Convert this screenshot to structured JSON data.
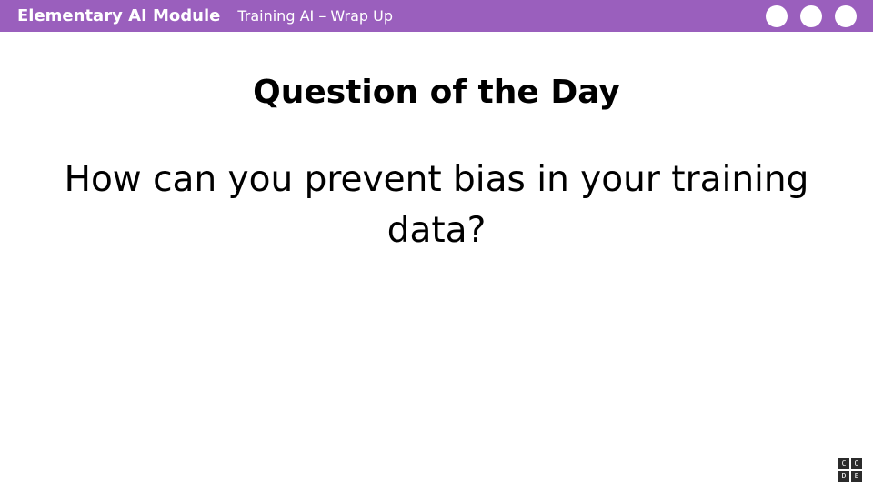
{
  "colors": {
    "header_bg": "#9a5fbd",
    "text": "#000000",
    "logo_bg": "#2b2b2b"
  },
  "header": {
    "module_title": "Elementary AI Module",
    "lesson_title": "Training AI – Wrap Up",
    "dots": [
      "circle",
      "circle",
      "circle"
    ]
  },
  "slide": {
    "heading": "Question of the Day",
    "question": "How can you prevent bias in your training data?"
  },
  "logo": {
    "letters": [
      "C",
      "O",
      "D",
      "E"
    ]
  }
}
